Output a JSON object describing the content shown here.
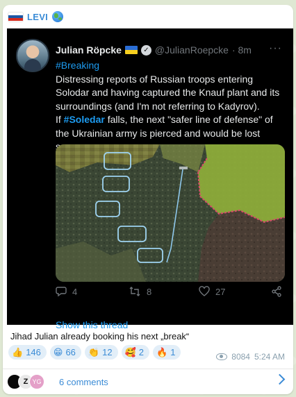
{
  "channel": {
    "name": "LEVI",
    "flag_icon": "russia-flag-icon",
    "badge_icon": "globe-icon"
  },
  "tweet": {
    "author_name": "Julian Röpcke",
    "author_flag_icon": "ukraine-flag-icon",
    "handle": "@JulianRoepcke",
    "time": "· 8m",
    "hashtag_line": "#Breaking",
    "body": "Distressing reports of Russian troops entering Solodar and having captured the Knauf plant and its surroundings (and I'm not referring to Kadyrov).",
    "line_if": "If",
    "tag_soledar": "#Soledar",
    "line_rest": "falls, the next \"safer line of defense\" of the Ukrainian army is pierced and would be lost soon.",
    "replies": "4",
    "retweets": "8",
    "likes": "27",
    "show_thread": "Show this thread"
  },
  "post": {
    "caption": "Jihad Julian already booking his next „break“",
    "views": "8084",
    "time": "5:24 AM"
  },
  "reactions": [
    {
      "emoji": "👍",
      "icon": "thumbs-up-icon",
      "count": "146"
    },
    {
      "emoji": "😁",
      "icon": "grin-icon",
      "count": "66"
    },
    {
      "emoji": "👏",
      "icon": "clap-icon",
      "count": "12"
    },
    {
      "emoji": "🥰",
      "icon": "love-face-icon",
      "count": "2"
    },
    {
      "emoji": "🔥",
      "icon": "fire-icon",
      "count": "1"
    }
  ],
  "comments": {
    "label": "6 comments",
    "avatar_letters": "Z",
    "avatar_initials": "YG"
  },
  "colors": {
    "accent": "#3a8bd6",
    "twitter_blue": "#1d9bf0",
    "tweet_bg": "#000000",
    "page_bg": "#dfe8d3"
  }
}
